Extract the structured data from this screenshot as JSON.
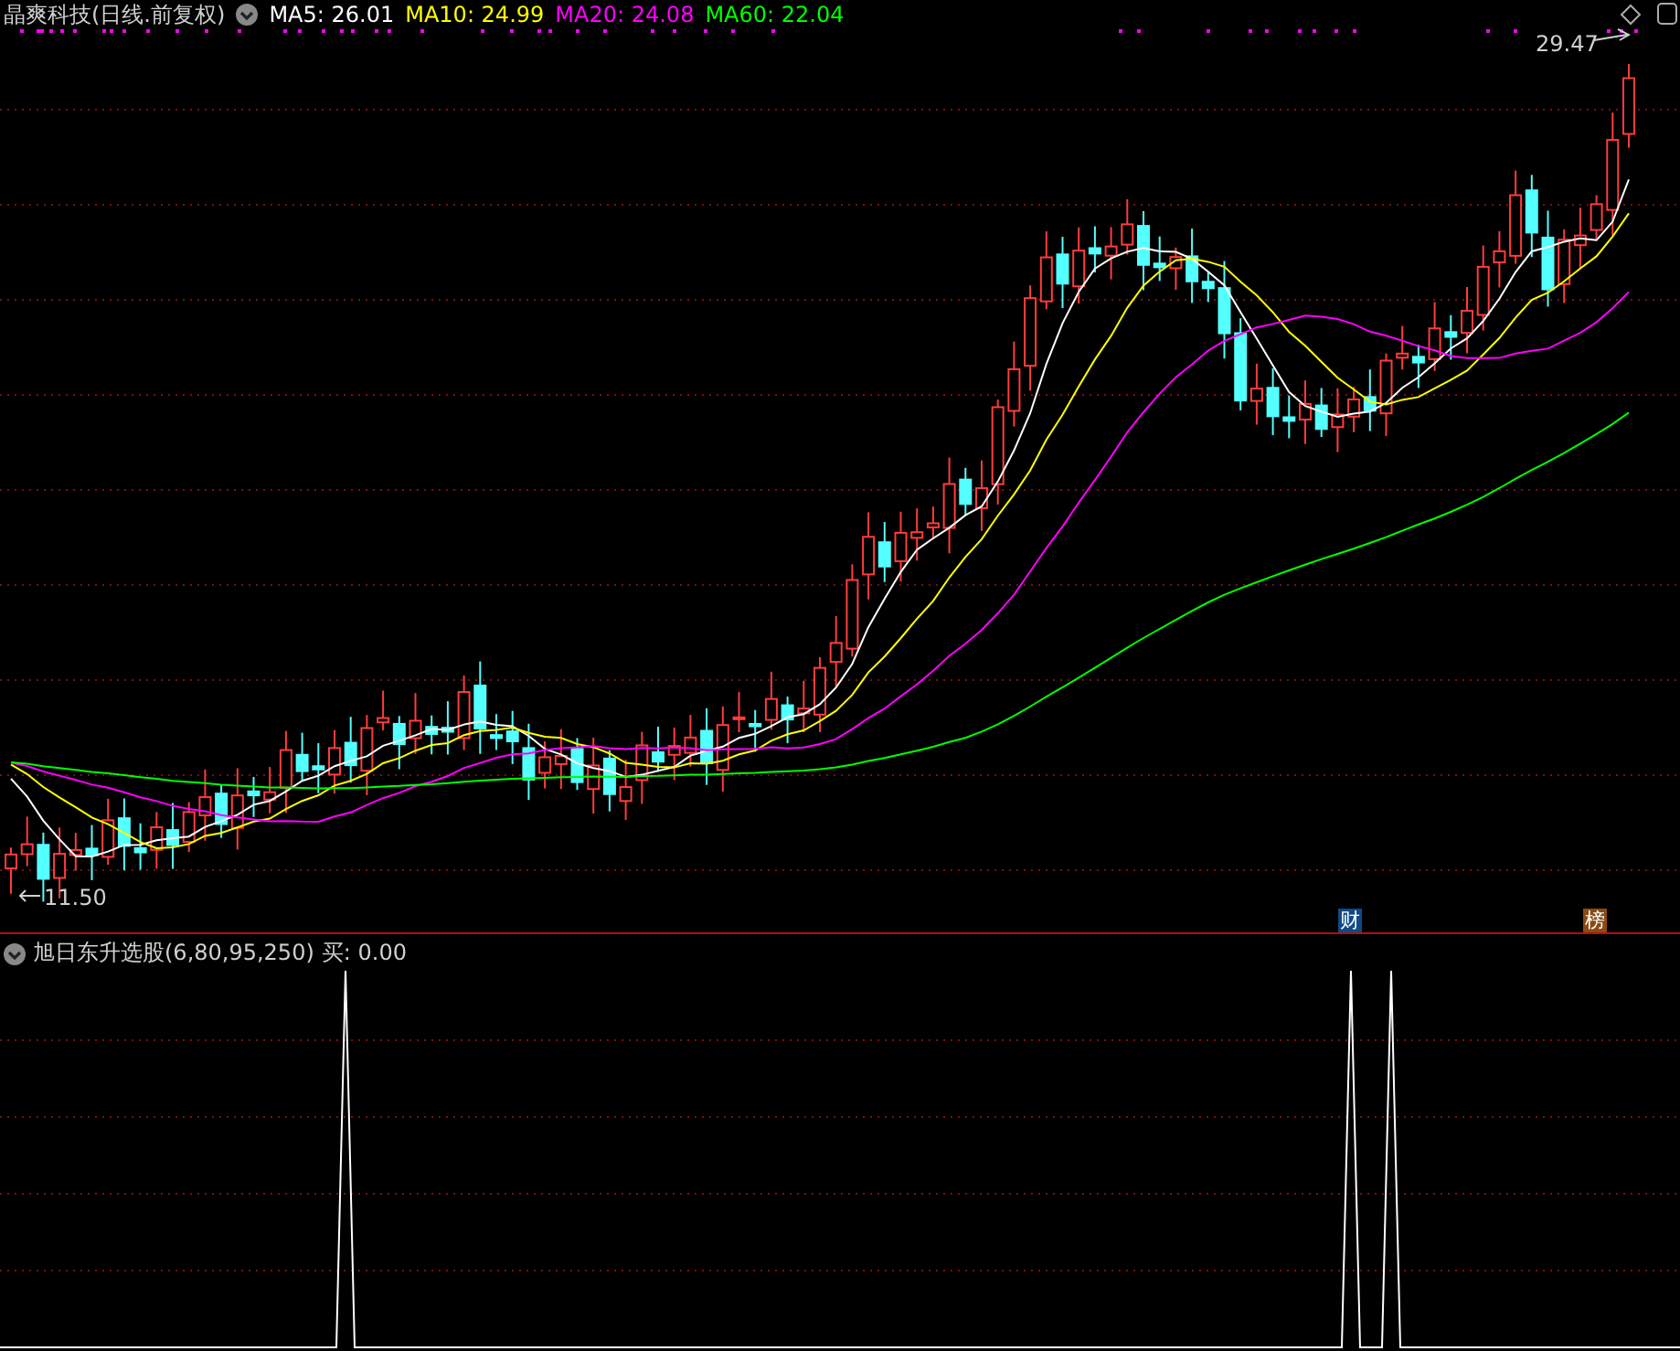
{
  "header": {
    "title": "晶爽科技(日线.前复权)",
    "ma": [
      {
        "label": "MA5: 26.01",
        "color": "#ffffff"
      },
      {
        "label": "MA10: 24.99",
        "color": "#ffff00"
      },
      {
        "label": "MA20: 24.08",
        "color": "#ff00ff"
      },
      {
        "label": "MA60: 22.04",
        "color": "#00ff00"
      }
    ]
  },
  "price_labels": {
    "high": "29.47",
    "low": "11.50"
  },
  "badges": [
    {
      "label": "财",
      "color": "#0f4a86"
    },
    {
      "label": "榜",
      "color": "#8a4a12"
    }
  ],
  "indicator": {
    "title": "旭日东升选股(6,80,95,250)",
    "reading": "买: 0.00"
  }
}
